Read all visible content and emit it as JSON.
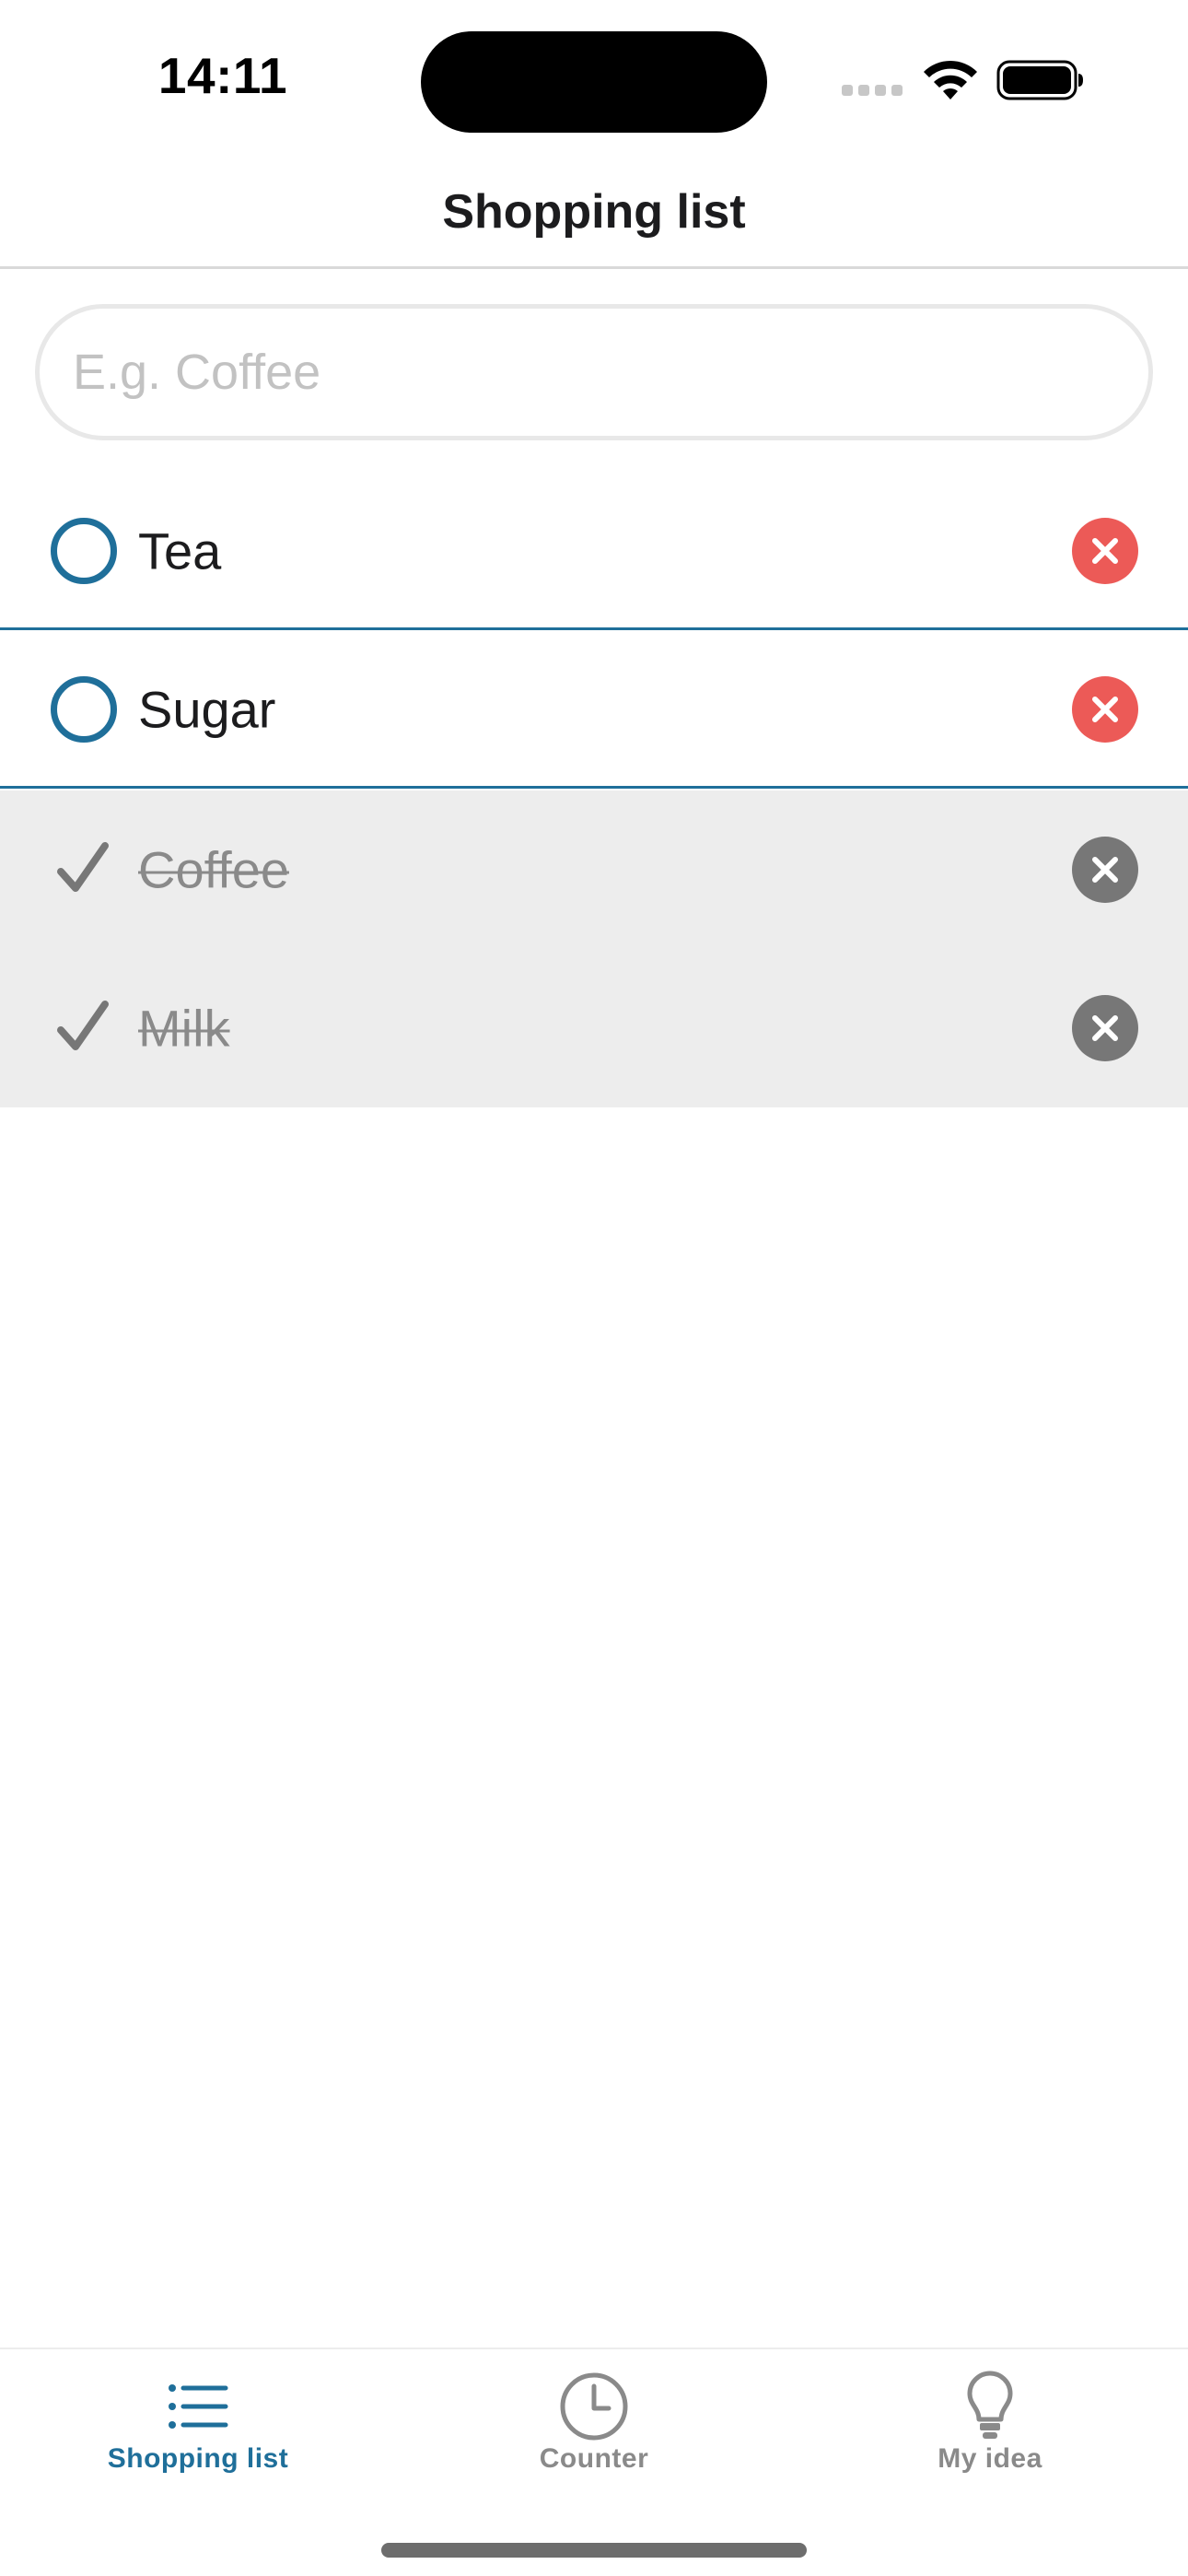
{
  "status_bar": {
    "time": "14:11"
  },
  "header": {
    "title": "Shopping list"
  },
  "search": {
    "placeholder": "E.g. Coffee",
    "value": ""
  },
  "list": {
    "items": [
      {
        "label": "Tea",
        "checked": false
      },
      {
        "label": "Sugar",
        "checked": false
      },
      {
        "label": "Coffee",
        "checked": true
      },
      {
        "label": "Milk",
        "checked": true
      }
    ]
  },
  "tab_bar": {
    "tabs": [
      {
        "label": "Shopping list",
        "icon": "list-icon",
        "active": true
      },
      {
        "label": "Counter",
        "icon": "clock-icon",
        "active": false
      },
      {
        "label": "My idea",
        "icon": "lightbulb-icon",
        "active": false
      }
    ]
  },
  "colors": {
    "accent": "#1f6f9a",
    "delete_active": "#ec5a57",
    "delete_done": "#777777",
    "done_background": "#ededed",
    "inactive_tab": "#8a8a8a"
  }
}
